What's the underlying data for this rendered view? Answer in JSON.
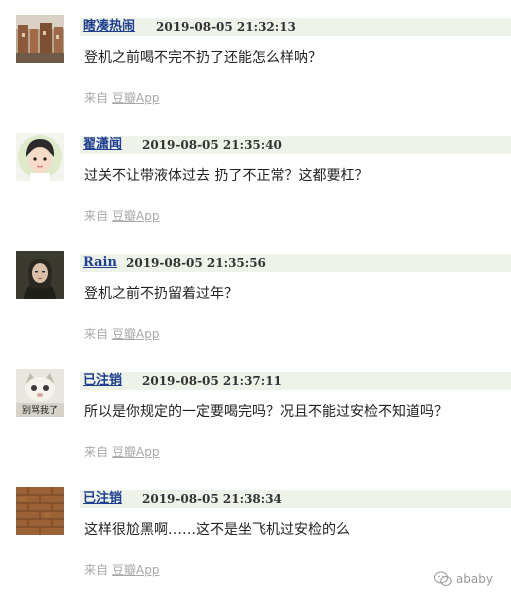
{
  "comments": [
    {
      "author": "瞎凑热闹",
      "time": "2019-08-05 21:32:13",
      "text": "登机之前喝不完不扔了还能怎么样呐？",
      "source_prefix": "来自",
      "source_app": "豆瓣App",
      "avatar": "avatar-ruins-photo"
    },
    {
      "author": "翟潇闻",
      "time": "2019-08-05 21:35:40",
      "text": "过关不让带液体过去 扔了不正常？这都要杠？",
      "source_prefix": "来自",
      "source_app": "豆瓣App",
      "avatar": "avatar-cartoon-boy"
    },
    {
      "author": "Rain",
      "time": "2019-08-05 21:35:56",
      "text": "登机之前不扔留着过年？",
      "source_prefix": "来自",
      "source_app": "豆瓣App",
      "avatar": "avatar-portrait-woman"
    },
    {
      "author": "已注销",
      "time": "2019-08-05 21:37:11",
      "text": "所以是你规定的一定要喝完吗？况且不能过安检不知道吗？",
      "source_prefix": "来自",
      "source_app": "豆瓣App",
      "avatar": "avatar-cat-meme",
      "avatar_caption": "别骂我了"
    },
    {
      "author": "已注销",
      "time": "2019-08-05 21:38:34",
      "text": "这样很尬黑啊……这不是坐飞机过安检的么",
      "source_prefix": "来自",
      "source_app": "豆瓣App",
      "avatar": "avatar-brick-wall"
    }
  ],
  "watermark": {
    "text": "ababy",
    "icon": "wechat-icon"
  }
}
